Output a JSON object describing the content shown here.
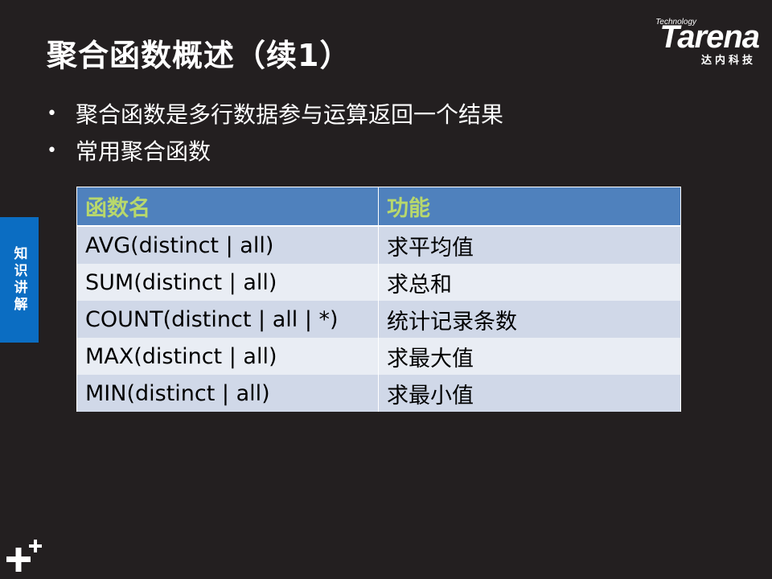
{
  "slide": {
    "title": "聚合函数概述（续1）",
    "bullets": [
      "聚合函数是多行数据参与运算返回一个结果",
      "常用聚合函数"
    ],
    "side_tab": "知识讲解"
  },
  "logo": {
    "technology": "Technology",
    "brand": "Tarena",
    "chinese": "达内科技"
  },
  "table": {
    "headers": [
      "函数名",
      "功能"
    ],
    "rows": [
      [
        "AVG(distinct | all)",
        "求平均值"
      ],
      [
        "SUM(distinct | all)",
        "求总和"
      ],
      [
        "COUNT(distinct | all | *)",
        "统计记录条数"
      ],
      [
        "MAX(distinct | all)",
        "求最大值"
      ],
      [
        "MIN(distinct | all)",
        "求最小值"
      ]
    ]
  },
  "colors": {
    "background": "#231f20",
    "header_bg": "#4f81bd",
    "header_text": "#b8d86c",
    "row_odd": "#d0d8e8",
    "row_even": "#e9edf4",
    "side_tab": "#0b6dc2"
  },
  "icons": {
    "bottom_left": "plus-plus-icon",
    "bullet": "bullet-dot-icon"
  }
}
